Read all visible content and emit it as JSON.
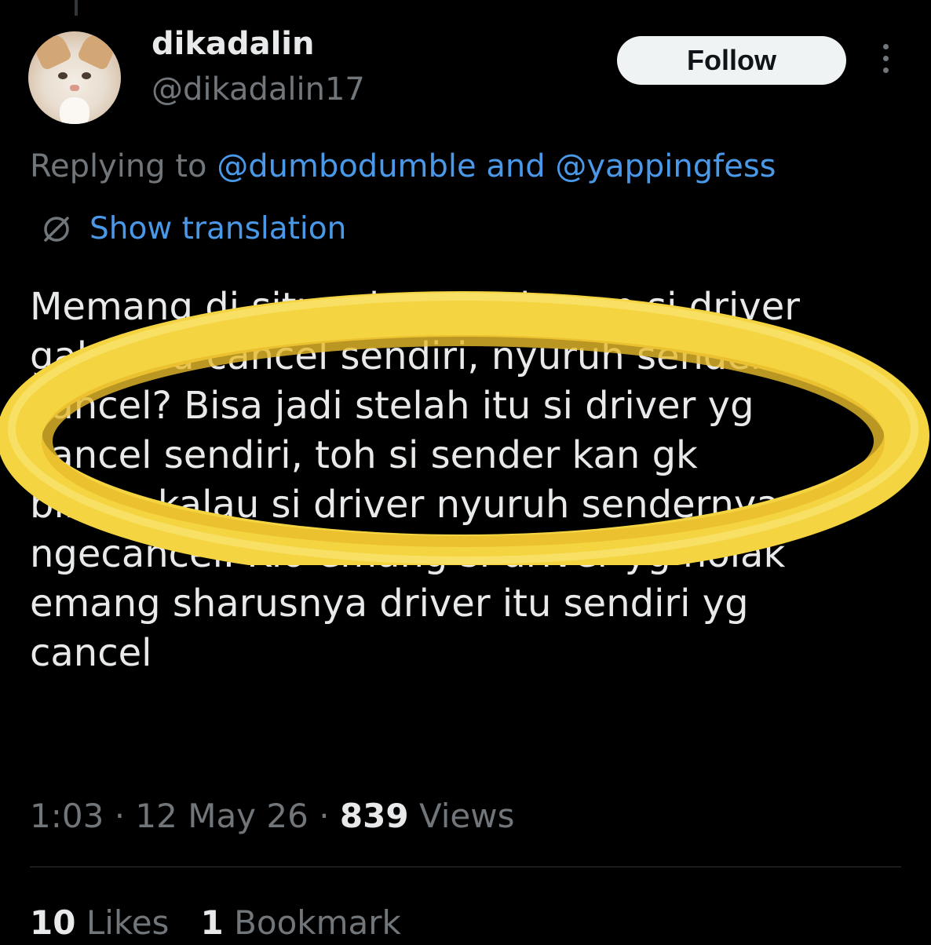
{
  "author": {
    "display_name": "dikadalin",
    "handle": "@dikadalin17",
    "avatar_icon": "cat-avatar"
  },
  "actions": {
    "follow_label": "Follow",
    "more_icon": "more-vertical-icon"
  },
  "reply": {
    "prefix": "Replying to",
    "mention_1": "@dumbodumble",
    "joiner": "and",
    "mention_2": "@yappingfess"
  },
  "translation": {
    "icon": "globe-icon",
    "label": "Show translation"
  },
  "tweet": {
    "text": "Memang di situ ada percakapan si driver\ngak mau cancel sendiri, nyuruh sender\ncancel? Bisa jadi stelah itu si driver yg\ncancel sendiri, toh si sender kan gk\nbilang kalau si driver nyuruh sendernya\nngecancel. Klo emang si driver yg nolak\nemang sharusnya driver itu sendiri yg\ncancel"
  },
  "meta": {
    "time": "1:03",
    "date": "12 May 26",
    "views_count": "839",
    "views_label": "Views"
  },
  "stats": {
    "likes_count": "10",
    "likes_label": "Likes",
    "bookmarks_count": "1",
    "bookmarks_label": "Bookmark"
  },
  "colors": {
    "background": "#000000",
    "link": "#4a99e9",
    "muted": "#71767b",
    "highlight": "#f5d442"
  }
}
